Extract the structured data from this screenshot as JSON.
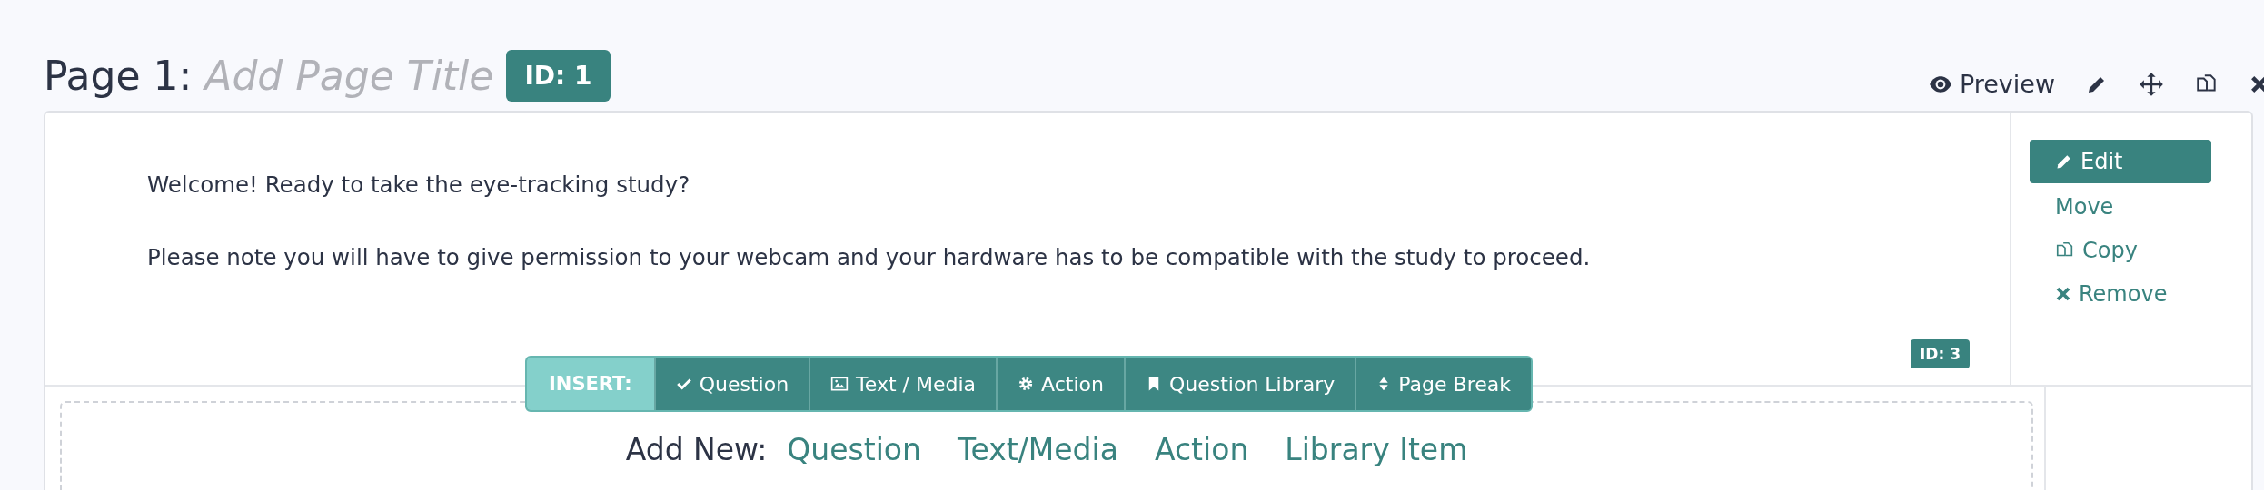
{
  "page": {
    "label": "Page 1:",
    "title_placeholder": "Add Page Title",
    "id_badge": "ID: 1"
  },
  "header_actions": [
    {
      "kind": "preview",
      "label": "Preview"
    },
    {
      "kind": "edit"
    },
    {
      "kind": "move"
    },
    {
      "kind": "copy"
    },
    {
      "kind": "remove"
    }
  ],
  "text_block": {
    "paragraphs": [
      "Welcome! Ready to take the eye-tracking study?",
      "Please note you will have to give permission to your webcam and your hardware has to be compatible with the study to proceed."
    ],
    "id_badge": "ID: 3"
  },
  "block_actions": [
    {
      "kind": "edit",
      "label": "Edit",
      "selected": true
    },
    {
      "kind": "move",
      "label": "Move",
      "selected": false
    },
    {
      "kind": "copy",
      "label": "Copy",
      "selected": false
    },
    {
      "kind": "remove",
      "label": "Remove",
      "selected": false
    }
  ],
  "insert_bar": {
    "label": "INSERT:",
    "items": [
      {
        "kind": "question",
        "label": "Question"
      },
      {
        "kind": "media",
        "label": "Text / Media"
      },
      {
        "kind": "action",
        "label": "Action"
      },
      {
        "kind": "library",
        "label": "Question Library"
      },
      {
        "kind": "pagebreak",
        "label": "Page Break"
      }
    ]
  },
  "add_new": {
    "label": "Add New:",
    "links": [
      "Question",
      "Text/Media",
      "Action",
      "Library Item"
    ]
  }
}
